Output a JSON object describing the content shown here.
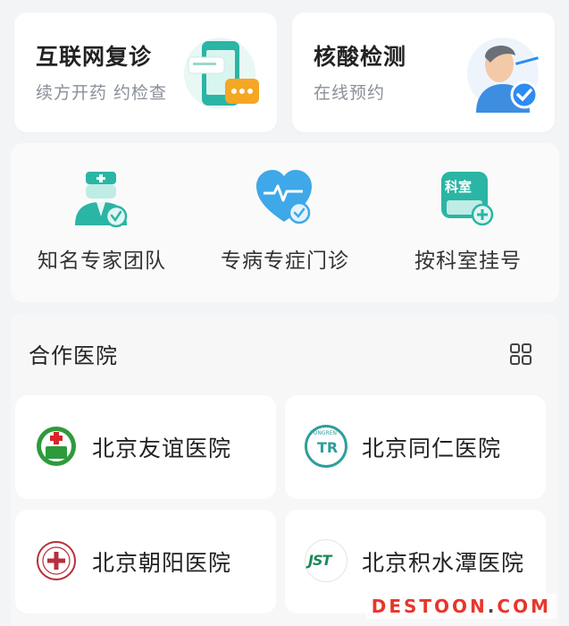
{
  "services": [
    {
      "title": "互联网复诊",
      "subtitle": "续方开药 约检查",
      "icon": "phone-chat-icon"
    },
    {
      "title": "核酸检测",
      "subtitle": "在线预约",
      "icon": "swab-test-icon"
    }
  ],
  "quick": [
    {
      "label": "知名专家团队",
      "icon": "doctor-icon"
    },
    {
      "label": "专病专症门诊",
      "icon": "heart-pulse-icon"
    },
    {
      "label": "按科室挂号",
      "icon": "department-icon",
      "badge": "科室"
    }
  ],
  "section": {
    "title": "合作医院"
  },
  "hospitals": [
    {
      "name": "北京友谊医院",
      "logo": "youyi-logo"
    },
    {
      "name": "北京同仁医院",
      "logo": "tongren-logo",
      "logo_text": "TONGREN"
    },
    {
      "name": "北京朝阳医院",
      "logo": "chaoyang-logo"
    },
    {
      "name": "北京积水潭医院",
      "logo": "jishuitan-logo",
      "logo_text": "JST"
    }
  ],
  "watermark": {
    "brand": "DESTOON",
    "dot": ".",
    "tld": "COM"
  },
  "colors": {
    "accent": "#2bb5a4",
    "blue": "#2d8cf0",
    "orange": "#f5a623",
    "watermark": "#e8362b"
  }
}
